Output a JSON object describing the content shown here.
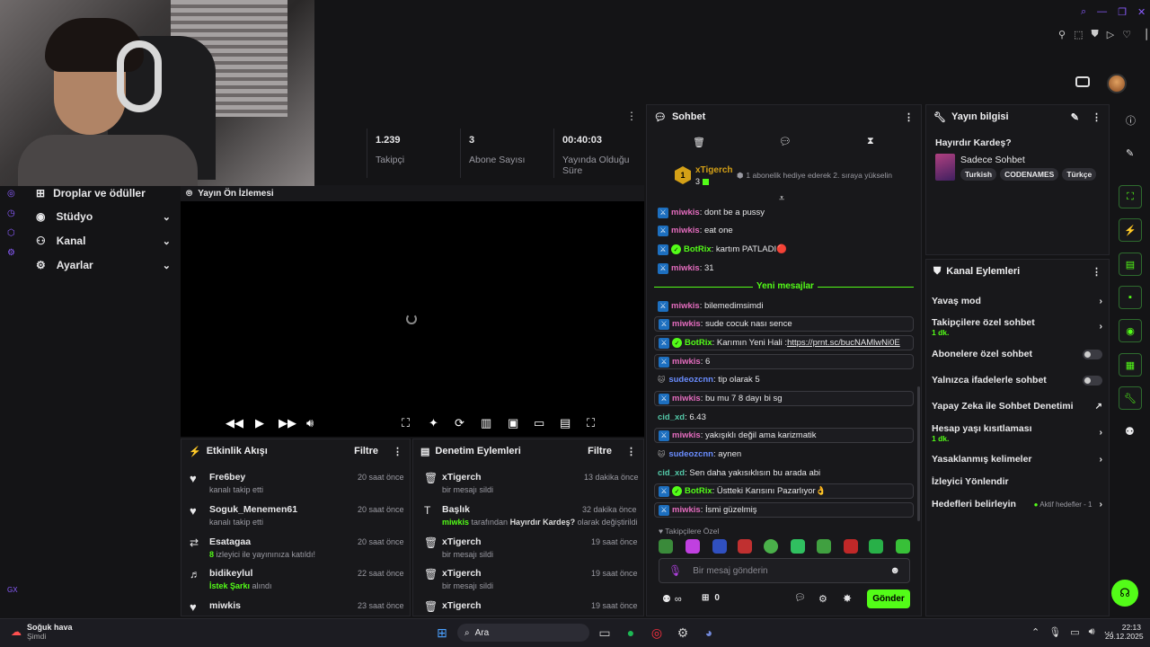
{
  "stats": [
    {
      "value": "1.239",
      "label": "Takipçi"
    },
    {
      "value": "3",
      "label": "Abone Sayısı"
    },
    {
      "value": "00:40:03",
      "label": "Yayında Olduğu Süre"
    }
  ],
  "nav": [
    {
      "label": "Droplar ve ödüller"
    },
    {
      "label": "Stüdyo"
    },
    {
      "label": "Kanal"
    },
    {
      "label": "Ayarlar"
    }
  ],
  "preview": {
    "title": "Yayın Ön İzlemesi"
  },
  "activity": {
    "title": "Etkinlik Akışı",
    "filter": "Filtre",
    "items": [
      {
        "name": "Fre6bey",
        "sub": "kanalı takip etti",
        "time": "20 saat önce"
      },
      {
        "name": "Soguk_Menemen61",
        "sub": "kanalı takip etti",
        "time": "20 saat önce"
      },
      {
        "name": "Esatagaa",
        "sub_hl": "8",
        "sub": " izleyici ile yayınınıza katıldı!",
        "time": "20 saat önce"
      },
      {
        "name": "bidikeylul",
        "sub_hl": "İstek Şarkı",
        "sub": " alındı",
        "time": "22 saat önce"
      },
      {
        "name": "miwkis",
        "sub": "",
        "time": "23 saat önce"
      }
    ]
  },
  "moderation": {
    "title": "Denetim Eylemleri",
    "filter": "Filtre",
    "items": [
      {
        "name": "xTigerch",
        "sub": "bir mesajı sildi",
        "time": "13 dakika önce"
      },
      {
        "name": "Başlık",
        "sub_user": "miwkis",
        "sub_mid": " tarafından ",
        "sub_bold": "Hayırdır Kardeş?",
        "sub": " olarak değiştirildi",
        "time": "32 dakika önce"
      },
      {
        "name": "xTigerch",
        "sub": "bir mesajı sildi",
        "time": "19 saat önce"
      },
      {
        "name": "xTigerch",
        "sub": "bir mesajı sildi",
        "time": "19 saat önce"
      },
      {
        "name": "xTigerch",
        "sub": "",
        "time": "19 saat önce"
      }
    ]
  },
  "chat": {
    "title": "Sohbet",
    "pinned": {
      "user": "xTigerch",
      "badge_count": "1",
      "sub_count": "3",
      "text": "1 abonelik hediye ederek 2. sıraya yükselin"
    },
    "new_messages": "Yeni mesajlar",
    "messages": [
      {
        "user": "miwkis",
        "text": ": dont be a pussy"
      },
      {
        "user": "miwkis",
        "text": ": eat one"
      },
      {
        "user": "BotRix",
        "text": ": kartım PATLADI🔴"
      },
      {
        "user": "miwkis",
        "text": ": 31"
      },
      {
        "user": "miwkis",
        "text": ": bilemedimsimdi"
      },
      {
        "user": "miwkis",
        "text": ": sude cocuk nası sence"
      },
      {
        "user": "BotRix",
        "text": ": Karımın Yeni Hali : ",
        "link": "https://prnt.sc/bucNAMlwNi0E"
      },
      {
        "user": "miwkis",
        "text": ": 6"
      },
      {
        "user": "sudeozcnn",
        "text": ": tip olarak 5"
      },
      {
        "user": "miwkis",
        "text": ": bu mu 7 8 dayı bi sg"
      },
      {
        "user": "cid_xd",
        "text": ": 6.43"
      },
      {
        "user": "miwkis",
        "text": ": yakışıklı değil ama karizmatik"
      },
      {
        "user": "sudeozcnn",
        "text": ": aynen"
      },
      {
        "user": "cid_xd",
        "text": ": Sen daha yakısıklısın bu arada abi"
      },
      {
        "user": "BotRix",
        "text": ": Üstteki Karısını Pazarlıyor👌"
      },
      {
        "user": "miwkis",
        "text": ": İsmi güzelmiş"
      }
    ],
    "emote_label": "Takipçilere Özel",
    "input_placeholder": "Bir mesaj gönderin",
    "infinity": "∞",
    "count": "0",
    "send": "Gönder"
  },
  "stream_info": {
    "title": "Yayın bilgisi",
    "stream_title": "Hayırdır Kardeş?",
    "category": "Sadece Sohbet",
    "tags": [
      "Turkish",
      "CODENAMES",
      "Türkçe"
    ]
  },
  "channel_actions": {
    "title": "Kanal Eylemleri",
    "items": [
      {
        "label": "Yavaş mod",
        "kind": "chev"
      },
      {
        "label": "Takipçilere özel sohbet",
        "sub": "1 dk.",
        "kind": "chev"
      },
      {
        "label": "Abonelere özel sohbet",
        "kind": "toggle"
      },
      {
        "label": "Yalnızca ifadelerle sohbet",
        "kind": "toggle"
      },
      {
        "label": "Yapay Zeka ile Sohbet Denetimi",
        "kind": "ext"
      },
      {
        "label": "Hesap yaşı kısıtlaması",
        "sub": "1 dk.",
        "kind": "chev"
      },
      {
        "label": "Yasaklanmış kelimeler",
        "kind": "chev"
      },
      {
        "label": "İzleyici Yönlendir",
        "kind": "none"
      },
      {
        "label": "Hedefleri belirleyin",
        "extra": "Aktif hedefler - 1",
        "kind": "chev"
      }
    ]
  },
  "taskbar": {
    "weather": "Soğuk hava",
    "weather_sub": "Şimdi",
    "search": "Ara",
    "time": "22:13",
    "date": "29.12.2025"
  },
  "colors": {
    "accent": "#53fc18",
    "bg": "#141416",
    "panel": "#18181b"
  }
}
